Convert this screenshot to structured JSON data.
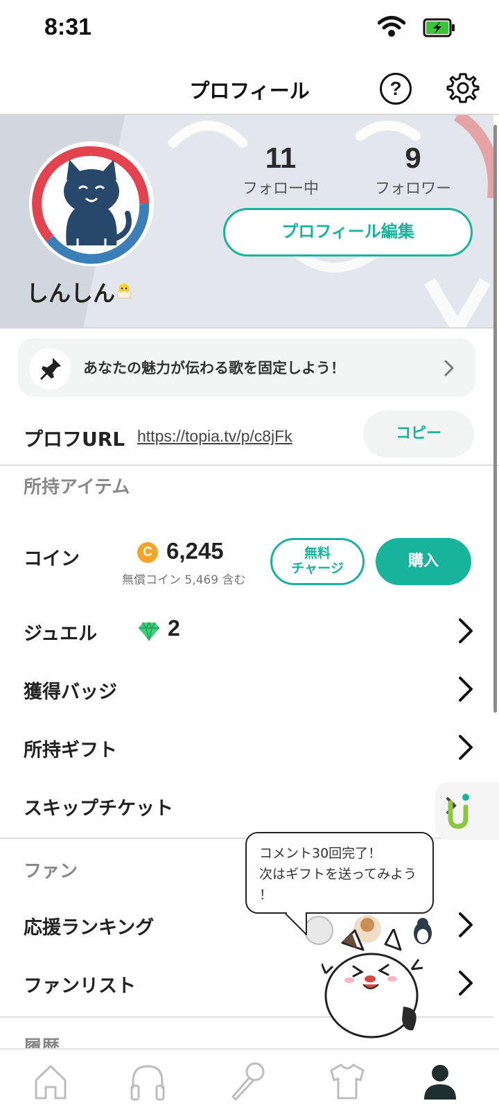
{
  "status_bar": {
    "time": "8:31"
  },
  "header": {
    "title": "プロフィール",
    "help_symbol": "?"
  },
  "profile": {
    "username": "しんしん",
    "following": {
      "count": "11",
      "label": "フォロー中"
    },
    "followers": {
      "count": "9",
      "label": "フォロワー"
    },
    "edit_button": "プロフィール編集"
  },
  "pin_banner": {
    "text": "あなたの魅力が伝わる歌を固定しよう！"
  },
  "profile_url": {
    "label": "プロフURL",
    "url": "https://topia.tv/p/c8jFk",
    "copy_button": "コピー"
  },
  "items_section": {
    "title": "所持アイテム",
    "coin": {
      "label": "コイン",
      "icon_letter": "C",
      "amount": "6,245",
      "note": "無償コイン 5,469 含む",
      "free_charge_line1": "無料",
      "free_charge_line2": "チャージ",
      "buy_button": "購入"
    },
    "jewel": {
      "label": "ジュエル",
      "count": "2"
    },
    "badges": {
      "label": "獲得バッジ"
    },
    "gifts": {
      "label": "所持ギフト"
    },
    "skip_ticket": {
      "label": "スキップチケット"
    }
  },
  "fan_section": {
    "title": "ファン",
    "ranking": {
      "label": "応援ランキング"
    },
    "fan_list": {
      "label": "ファンリスト"
    }
  },
  "history_section": {
    "title": "履歴"
  },
  "speech_bubble": {
    "line1": "コメント30回完了！",
    "line2": "次はギフトを送ってみよう",
    "line3": "！"
  },
  "bottom_nav": {
    "items": [
      "home-icon",
      "headphones-icon",
      "microphone-icon",
      "tshirt-icon",
      "profile-icon"
    ],
    "active": "profile-icon",
    "active_color": "#1f2f2f",
    "inactive_color": "#bdbdbd"
  },
  "colors": {
    "accent": "#17b39a",
    "coin": "#f2a526",
    "jewel": "#3ccf7a"
  }
}
